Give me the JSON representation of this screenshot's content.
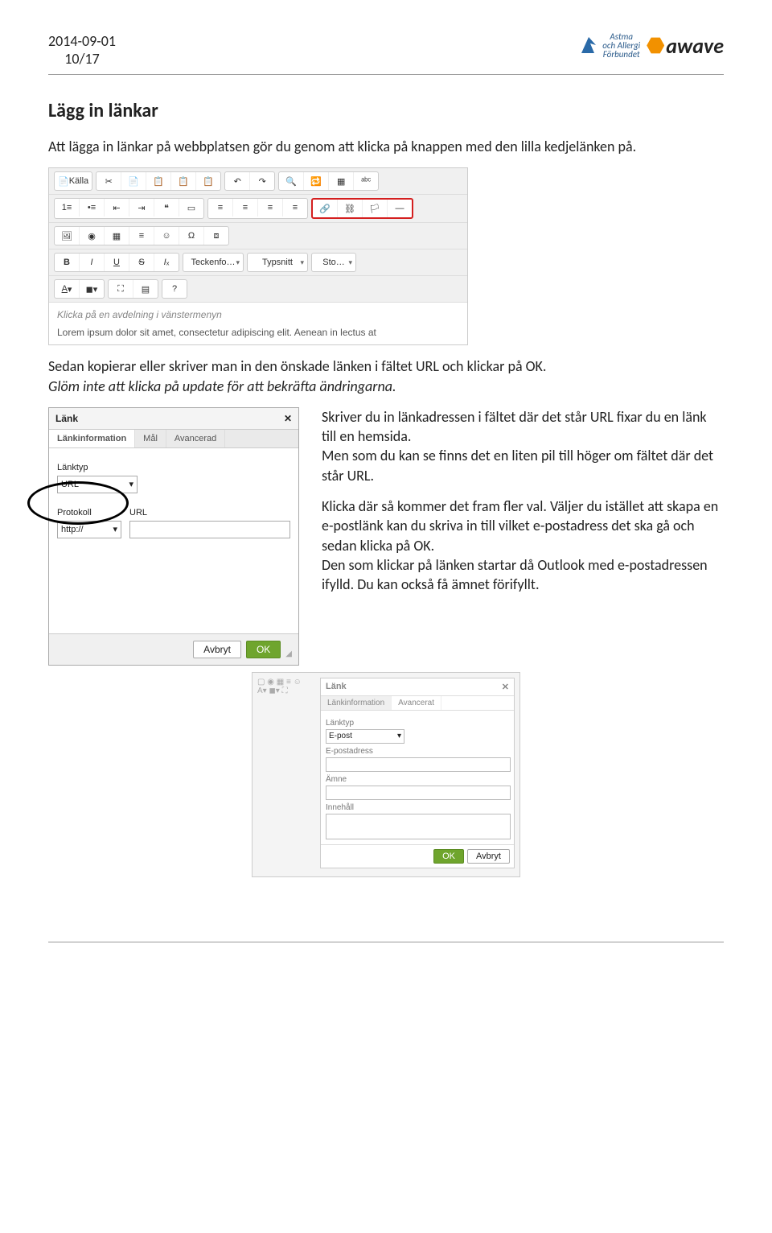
{
  "header": {
    "date": "2014-09-01",
    "page": "10/17"
  },
  "logos": {
    "aaf_line1": "Astma",
    "aaf_line2": "och Allergi",
    "aaf_line3": "Förbundet",
    "awave": "awave"
  },
  "title": "Lägg in länkar",
  "intro": "Att lägga in länkar på webbplatsen gör du genom att klicka på knappen med den lilla kedjelänken på.",
  "editor": {
    "source_btn": "Källa",
    "font_family_label": "Teckenfo…",
    "font_name_label": "Typsnitt",
    "font_size_label": "Sto…",
    "content_line1": "Klicka på en avdelning i vänstermenyn",
    "content_line2": "Lorem ipsum dolor sit amet, consectetur adipiscing elit. Aenean in lectus at"
  },
  "para2": "Sedan kopierar eller skriver man in den önskade länken i fältet URL och klickar på OK.",
  "para2_italic": "Glöm inte att klicka på update för att bekräfta ändringarna.",
  "link_dialog": {
    "title": "Länk",
    "tab1": "Länkinformation",
    "tab2": "Mål",
    "tab3": "Avancerad",
    "linktype_label": "Länktyp",
    "linktype_value": "URL",
    "protokoll_label": "Protokoll",
    "protokoll_value": "http://",
    "url_label": "URL",
    "cancel": "Avbryt",
    "ok": "OK"
  },
  "right1": "Skriver du in länkadressen i fältet där det står URL fixar du en länk till en hemsida.",
  "right2": "Men som du kan se finns det en liten pil till höger om fältet där det står URL.",
  "right3": "Klicka där så kommer det fram fler val. Väljer du istället att skapa en e-postlänk  kan du skriva in till vilket e-postadress det ska gå och sedan klicka på OK.",
  "right4": " Den som klickar på länken startar då Outlook med e-postadressen ifylld. Du kan också få ämnet förifyllt.",
  "epost_dialog": {
    "title": "Länk",
    "tab1": "Länkinformation",
    "tab2": "Avancerat",
    "linktype_label": "Länktyp",
    "linktype_value": "E-post",
    "epost_label": "E-postadress",
    "amne_label": "Ämne",
    "innehall_label": "Innehåll",
    "ok": "OK",
    "cancel": "Avbryt"
  }
}
